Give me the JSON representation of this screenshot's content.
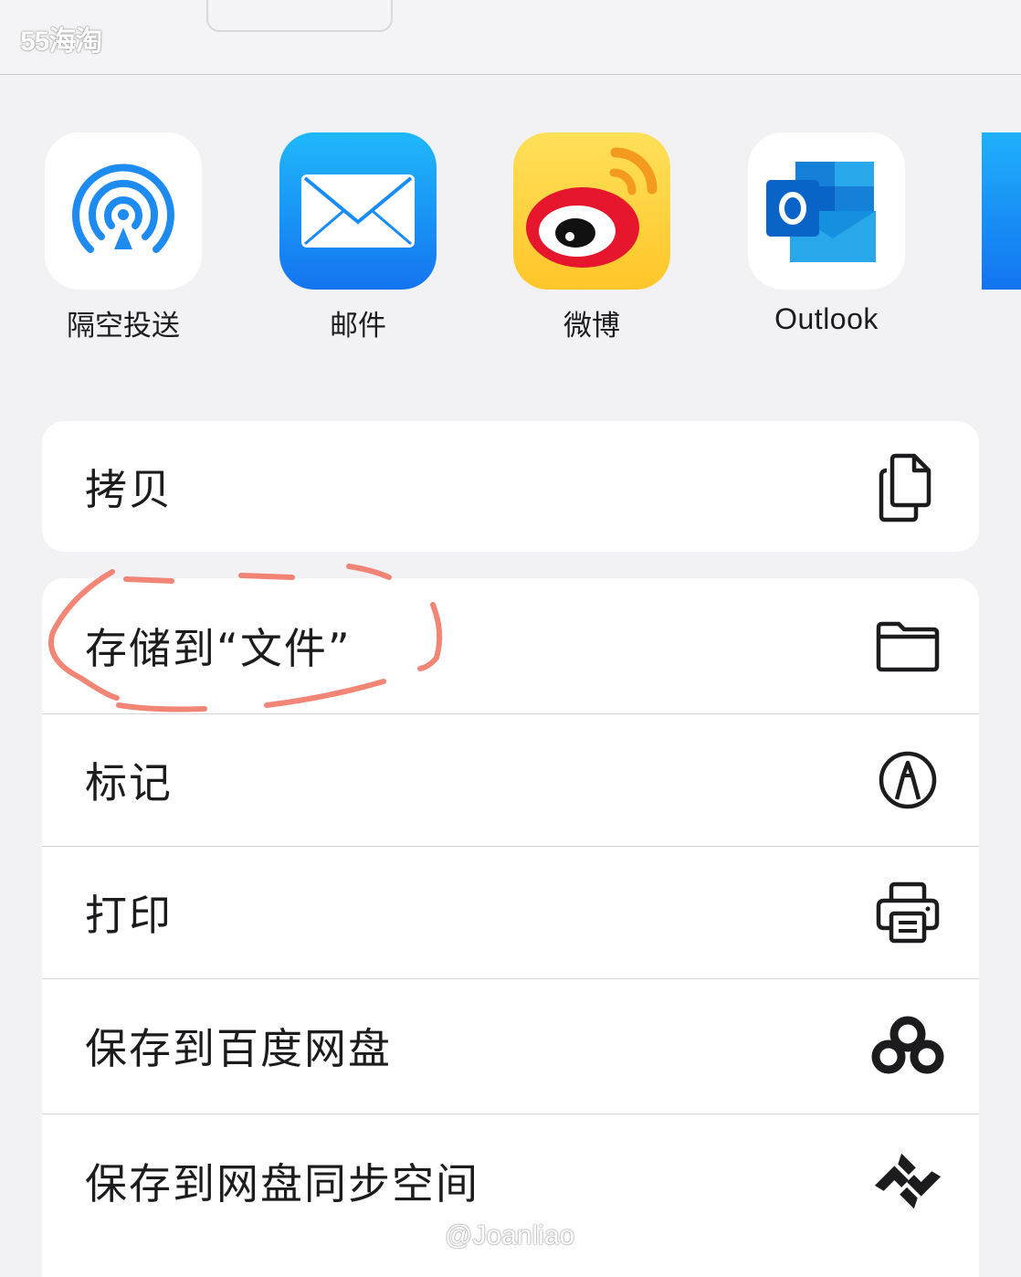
{
  "watermark_top": "55海淘",
  "watermark_bottom": "@Joanliao",
  "apps": [
    {
      "name": "airdrop",
      "label": "隔空投送"
    },
    {
      "name": "mail",
      "label": "邮件"
    },
    {
      "name": "weibo",
      "label": "微博"
    },
    {
      "name": "outlook",
      "label": "Outlook"
    }
  ],
  "actions": {
    "copy": {
      "label": "拷贝",
      "icon": "copy-icon"
    },
    "save_to_files": {
      "label": "存储到“文件”",
      "icon": "folder-icon"
    },
    "markup": {
      "label": "标记",
      "icon": "markup-icon"
    },
    "print": {
      "label": "打印",
      "icon": "printer-icon"
    },
    "save_baidu": {
      "label": "保存到百度网盘",
      "icon": "baidu-netdisk-icon"
    },
    "save_sync": {
      "label": "保存到网盘同步空间",
      "icon": "sync-space-icon"
    }
  },
  "colors": {
    "highlight": "#f07868",
    "airdrop_blue": "#1e8bf0",
    "mail_blue": "#1a8cf7",
    "weibo_red": "#e6162d",
    "weibo_yellow": "#ffd13a",
    "outlook_blue": "#0a64c8"
  }
}
